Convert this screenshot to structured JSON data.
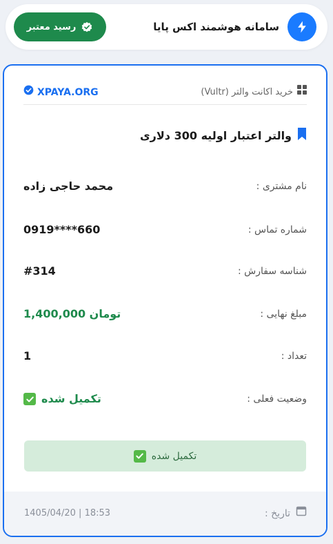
{
  "header": {
    "title": "سامانه هوشمند اکس پایا",
    "badge_label": "رسید معتبر"
  },
  "card": {
    "product_type": "خرید اکانت والتر (Vultr)",
    "brand": "XPAYA.ORG",
    "product_title": "والتر اعتبار اولیه 300 دلاری",
    "fields": [
      {
        "label": "نام مشتری :",
        "value": "محمد حاجی زاده"
      },
      {
        "label": "شماره تماس :",
        "value": "0919****660"
      },
      {
        "label": "شناسه سفارش :",
        "value": "#314"
      },
      {
        "label": "مبلغ نهایی :",
        "value": "1,400,000 تومان"
      },
      {
        "label": "تعداد :",
        "value": "1"
      },
      {
        "label": "وضعیت فعلی :",
        "value": "تکمیل شده"
      }
    ],
    "status_bar_label": "تکمیل شده",
    "date_label": "تاریخ :",
    "date_value": "1405/04/20 | 18:53"
  },
  "colors": {
    "accent_blue": "#1a6ff0",
    "success_green": "#1e8a4c",
    "status_bar_bg": "#d5ecdb"
  },
  "icons": {
    "header_icon": "lightning-bolt-icon",
    "badge_icon": "verified-check-icon",
    "product_type_icon": "grid-icon",
    "brand_icon": "verified-check-icon",
    "title_icon": "bookmark-icon",
    "status_icon": "checkbox-checked-icon",
    "date_icon": "calendar-icon"
  }
}
